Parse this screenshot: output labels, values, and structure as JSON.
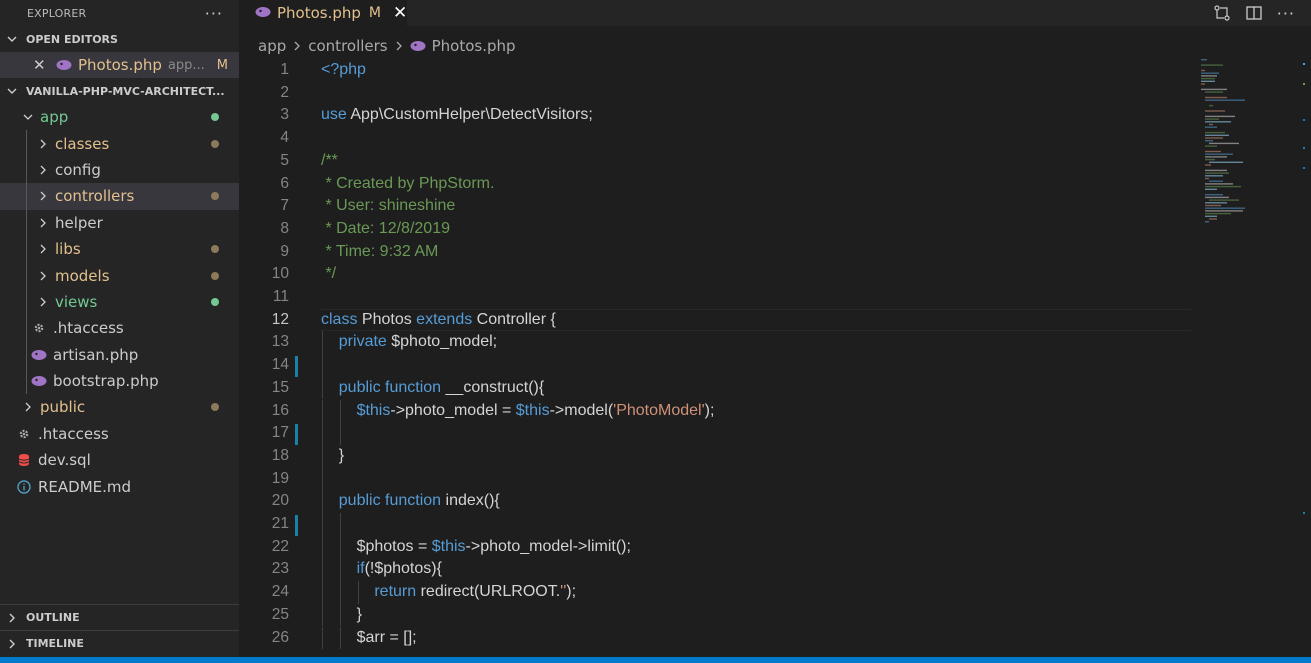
{
  "sidebar": {
    "title": "EXPLORER",
    "more": "···",
    "open_editors_header": "OPEN EDITORS",
    "open_editor": {
      "name": "Photos.php",
      "path": "app...",
      "status": "M"
    },
    "project_header": "VANILLA-PHP-MVC-ARCHITECT...",
    "tree": [
      {
        "label": "app",
        "type": "folder",
        "state": "open",
        "color": "#73c991",
        "dot": "#73c991",
        "depth": 0
      },
      {
        "label": "classes",
        "type": "folder",
        "state": "closed",
        "color": "#e2c08d",
        "dot": "#8c7a5a",
        "depth": 1
      },
      {
        "label": "config",
        "type": "folder",
        "state": "closed",
        "color": "#cccccc",
        "dot": "",
        "depth": 1
      },
      {
        "label": "controllers",
        "type": "folder",
        "state": "closed",
        "color": "#e2c08d",
        "dot": "#8c7a5a",
        "depth": 1,
        "selected": true
      },
      {
        "label": "helper",
        "type": "folder",
        "state": "closed",
        "color": "#cccccc",
        "dot": "",
        "depth": 1
      },
      {
        "label": "libs",
        "type": "folder",
        "state": "closed",
        "color": "#e2c08d",
        "dot": "#8c7a5a",
        "depth": 1
      },
      {
        "label": "models",
        "type": "folder",
        "state": "closed",
        "color": "#e2c08d",
        "dot": "#8c7a5a",
        "depth": 1
      },
      {
        "label": "views",
        "type": "folder",
        "state": "closed",
        "color": "#73c991",
        "dot": "#73c991",
        "depth": 1
      },
      {
        "label": ".htaccess",
        "type": "file",
        "icon": "gear",
        "color": "#cccccc",
        "dot": "",
        "depth": 1
      },
      {
        "label": "artisan.php",
        "type": "file",
        "icon": "php",
        "color": "#cccccc",
        "dot": "",
        "depth": 1
      },
      {
        "label": "bootstrap.php",
        "type": "file",
        "icon": "php",
        "color": "#cccccc",
        "dot": "",
        "depth": 1
      },
      {
        "label": "public",
        "type": "folder",
        "state": "closed",
        "color": "#e2c08d",
        "dot": "#8c7a5a",
        "depth": 0
      },
      {
        "label": ".htaccess",
        "type": "file",
        "icon": "gear",
        "color": "#cccccc",
        "dot": "",
        "depth": 0
      },
      {
        "label": "dev.sql",
        "type": "file",
        "icon": "db",
        "color": "#cccccc",
        "dot": "",
        "depth": 0
      },
      {
        "label": "README.md",
        "type": "file",
        "icon": "info",
        "color": "#cccccc",
        "dot": "",
        "depth": 0
      }
    ],
    "outline": "OUTLINE",
    "timeline": "TIMELINE"
  },
  "tab": {
    "name": "Photos.php",
    "status": "M"
  },
  "breadcrumb": [
    "app",
    "controllers",
    "Photos.php"
  ],
  "code": [
    {
      "n": 1,
      "t": [
        [
          "tag",
          "<?php"
        ]
      ]
    },
    {
      "n": 2,
      "t": []
    },
    {
      "n": 3,
      "t": [
        [
          "kw",
          "use "
        ],
        [
          "ns",
          "App\\CustomHelper\\DetectVisitors;"
        ]
      ]
    },
    {
      "n": 4,
      "t": []
    },
    {
      "n": 5,
      "t": [
        [
          "cm",
          "/**"
        ]
      ]
    },
    {
      "n": 6,
      "t": [
        [
          "cm",
          " * Created by PhpStorm."
        ]
      ]
    },
    {
      "n": 7,
      "t": [
        [
          "cm",
          " * User: shineshine"
        ]
      ]
    },
    {
      "n": 8,
      "t": [
        [
          "cm",
          " * Date: 12/8/2019"
        ]
      ]
    },
    {
      "n": 9,
      "t": [
        [
          "cm",
          " * Time: 9:32 AM"
        ]
      ]
    },
    {
      "n": 10,
      "t": [
        [
          "cm",
          " */"
        ]
      ]
    },
    {
      "n": 11,
      "t": []
    },
    {
      "n": 12,
      "t": [
        [
          "kw",
          "class "
        ],
        [
          "plain",
          "Photos "
        ],
        [
          "kw",
          "extends "
        ],
        [
          "plain",
          "Controller {"
        ]
      ],
      "active": true
    },
    {
      "n": 13,
      "t": [
        [
          "plain",
          "    "
        ],
        [
          "kw",
          "private "
        ],
        [
          "plain",
          "$photo_model;"
        ]
      ]
    },
    {
      "n": 14,
      "t": [],
      "changed": true
    },
    {
      "n": 15,
      "t": [
        [
          "plain",
          "    "
        ],
        [
          "kw",
          "public function "
        ],
        [
          "plain",
          "__construct(){"
        ]
      ]
    },
    {
      "n": 16,
      "t": [
        [
          "plain",
          "        "
        ],
        [
          "kw",
          "$this"
        ],
        [
          "plain",
          "->photo_model = "
        ],
        [
          "kw",
          "$this"
        ],
        [
          "plain",
          "->model("
        ],
        [
          "str",
          "'PhotoModel'"
        ],
        [
          "plain",
          ");"
        ]
      ]
    },
    {
      "n": 17,
      "t": [],
      "changed": true
    },
    {
      "n": 18,
      "t": [
        [
          "plain",
          "    }"
        ]
      ]
    },
    {
      "n": 19,
      "t": []
    },
    {
      "n": 20,
      "t": [
        [
          "plain",
          "    "
        ],
        [
          "kw",
          "public function "
        ],
        [
          "plain",
          "index(){"
        ]
      ]
    },
    {
      "n": 21,
      "t": [],
      "changed": true
    },
    {
      "n": 22,
      "t": [
        [
          "plain",
          "        $photos = "
        ],
        [
          "kw",
          "$this"
        ],
        [
          "plain",
          "->photo_model->limit();"
        ]
      ]
    },
    {
      "n": 23,
      "t": [
        [
          "plain",
          "        "
        ],
        [
          "kw",
          "if"
        ],
        [
          "plain",
          "(!$photos){"
        ]
      ]
    },
    {
      "n": 24,
      "t": [
        [
          "plain",
          "            "
        ],
        [
          "kw",
          "return "
        ],
        [
          "plain",
          "redirect(URLROOT."
        ],
        [
          "str",
          "''"
        ],
        [
          "plain",
          ");"
        ]
      ]
    },
    {
      "n": 25,
      "t": [
        [
          "plain",
          "        }"
        ]
      ]
    },
    {
      "n": 26,
      "t": [
        [
          "plain",
          "        $arr = [];"
        ]
      ]
    }
  ]
}
